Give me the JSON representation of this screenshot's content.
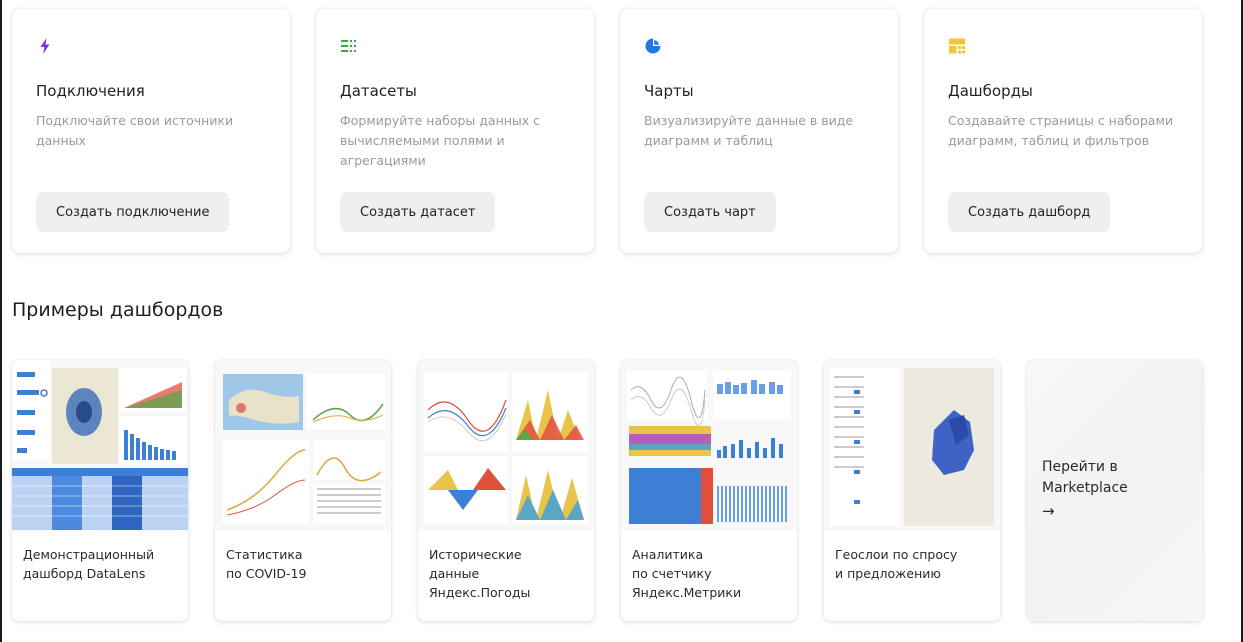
{
  "features": [
    {
      "title": "Подключения",
      "desc_lines": [
        "Подключайте свои источники",
        "данных"
      ],
      "button": "Создать подключение",
      "icon": "lightning-icon",
      "color": "#8c2bd1"
    },
    {
      "title": "Датасеты",
      "desc_lines": [
        "Формируйте наборы данных с",
        "вычисляемыми полями и",
        "агрегациями"
      ],
      "button": "Создать датасет",
      "icon": "dataset-grid-icon",
      "color": "#3aa83a"
    },
    {
      "title": "Чарты",
      "desc_lines": [
        "Визуализируйте данные в виде",
        "диаграмм и таблиц"
      ],
      "button": "Создать чарт",
      "icon": "pie-chart-icon",
      "color": "#1e78e6"
    },
    {
      "title": "Дашборды",
      "desc_lines": [
        "Создавайте страницы с наборами",
        "диаграмм, таблиц и фильтров"
      ],
      "button": "Создать дашборд",
      "icon": "dashboard-icon",
      "color": "#f2c53d"
    }
  ],
  "examples_title": "Примеры дашбордов",
  "examples": [
    {
      "name_lines": [
        "Демонстрационный",
        "дашборд DataLens"
      ]
    },
    {
      "name_lines": [
        "Статистика",
        "по COVID-19"
      ]
    },
    {
      "name_lines": [
        "Исторические",
        "данные",
        "Яндекс.Погоды"
      ]
    },
    {
      "name_lines": [
        "Аналитика",
        "по счетчику",
        "Яндекс.Метрики"
      ]
    },
    {
      "name_lines": [
        "Геослои по спросу",
        "и предложению"
      ]
    }
  ],
  "marketplace": {
    "label_lines": [
      "Перейти в",
      "Marketplace"
    ],
    "arrow": "→"
  }
}
